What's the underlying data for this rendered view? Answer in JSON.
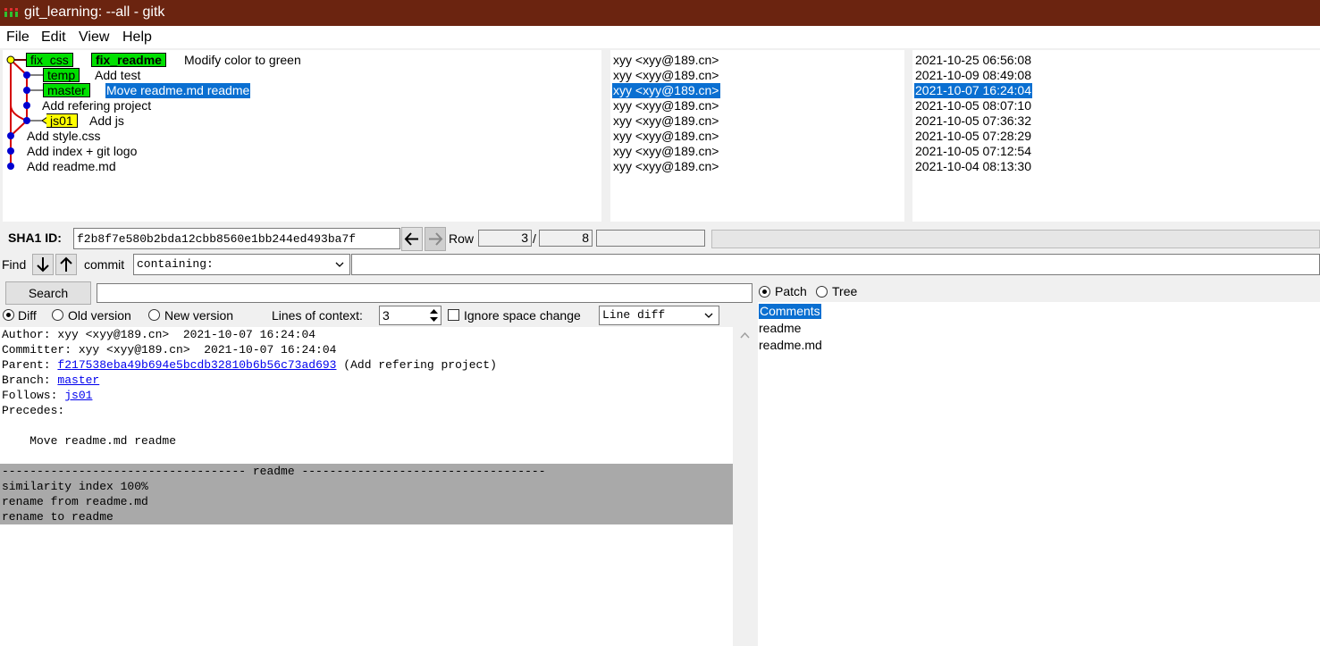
{
  "window": {
    "title": "git_learning: --all - gitk"
  },
  "menu": [
    "File",
    "Edit",
    "View",
    "Help"
  ],
  "commits": [
    {
      "refs": [
        {
          "name": "fix_css",
          "color": "green",
          "bold": false
        },
        {
          "name": "fix_readme",
          "color": "green",
          "bold": true
        }
      ],
      "message": "Modify color to green",
      "author": "xyy <xyy@189.cn>",
      "date": "2021-10-25 06:56:08"
    },
    {
      "refs": [
        {
          "name": "temp",
          "color": "green",
          "bold": false
        }
      ],
      "message": "Add test",
      "author": "xyy <xyy@189.cn>",
      "date": "2021-10-09 08:49:08"
    },
    {
      "refs": [
        {
          "name": "master",
          "color": "green",
          "bold": false
        }
      ],
      "message": "Move readme.md readme",
      "author": "xyy <xyy@189.cn>",
      "date": "2021-10-07 16:24:04",
      "selected": true
    },
    {
      "refs": [],
      "message": "Add refering project",
      "author": "xyy <xyy@189.cn>",
      "date": "2021-10-05 08:07:10"
    },
    {
      "refs": [
        {
          "name": "js01",
          "color": "yellow",
          "bold": false
        }
      ],
      "message": "Add js",
      "author": "xyy <xyy@189.cn>",
      "date": "2021-10-05 07:36:32"
    },
    {
      "refs": [],
      "message": "Add style.css",
      "author": "xyy <xyy@189.cn>",
      "date": "2021-10-05 07:28:29"
    },
    {
      "refs": [],
      "message": "Add index + git logo",
      "author": "xyy <xyy@189.cn>",
      "date": "2021-10-05 07:12:54"
    },
    {
      "refs": [],
      "message": "Add readme.md",
      "author": "xyy <xyy@189.cn>",
      "date": "2021-10-04 08:13:30"
    }
  ],
  "sha": {
    "label": "SHA1 ID:",
    "value": "f2b8f7e580b2bda12cbb8560e1bb244ed493ba7f",
    "row_label": "Row",
    "row": "3",
    "sep": "/",
    "total": "8"
  },
  "find": {
    "label": "Find",
    "commit_label": "commit",
    "mode": "containing:",
    "value": ""
  },
  "search": {
    "button": "Search",
    "value": ""
  },
  "diff_options": {
    "diff": "Diff",
    "old": "Old version",
    "new": "New version",
    "context_label": "Lines of context:",
    "context_value": "3",
    "ignore_space": "Ignore space change",
    "line_mode": "Line diff"
  },
  "patch_tree": {
    "patch": "Patch",
    "tree": "Tree"
  },
  "details": {
    "author": "Author: xyy <xyy@189.cn>  2021-10-07 16:24:04",
    "committer": "Committer: xyy <xyy@189.cn>  2021-10-07 16:24:04",
    "parent_label": "Parent: ",
    "parent_sha": "f217538eba49b694e5bcdb32810b6b56c73ad693",
    "parent_msg": " (Add refering project)",
    "branch_label": "Branch: ",
    "branch": "master",
    "follows_label": "Follows: ",
    "follows": "js01",
    "precedes_label": "Precedes:",
    "message": "    Move readme.md readme",
    "hunk_header": "----------------------------------- readme -----------------------------------",
    "hunk_lines": [
      "similarity index 100%",
      "rename from readme.md",
      "rename to readme"
    ]
  },
  "files": [
    {
      "name": "Comments",
      "selected": true
    },
    {
      "name": "readme",
      "selected": false
    },
    {
      "name": "readme.md",
      "selected": false
    }
  ],
  "colors": {
    "titlebar": "#6b2410",
    "selection": "#0a6fd1",
    "ref_green": "#00e000",
    "ref_yellow": "#ffff00",
    "graph_line": "#d40000",
    "graph_dot": "#0000d0"
  }
}
